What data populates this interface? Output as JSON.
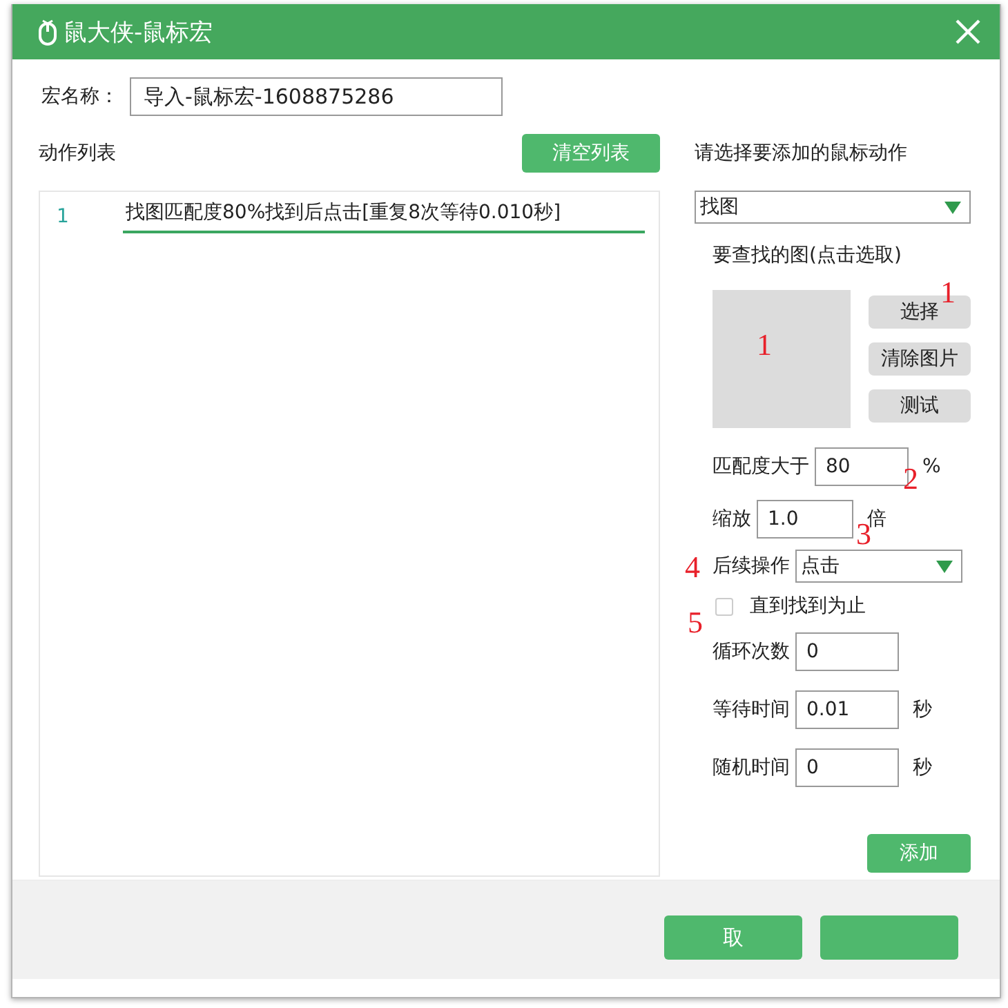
{
  "window": {
    "title": "鼠大侠-鼠标宏"
  },
  "macro_name": {
    "label": "宏名称：",
    "value": "导入-鼠标宏-1608875286"
  },
  "action_list": {
    "title": "动作列表",
    "clear_button": "清空列表",
    "rows": [
      {
        "index": "1",
        "text": "找图匹配度80%找到后点击[重复8次等待0.010秒]",
        "selected": true
      }
    ]
  },
  "action_panel": {
    "title": "请选择要添加的鼠标动作",
    "action_type": "找图",
    "image_section": {
      "label": "要查找的图(点击选取)",
      "preview_annotation": "1",
      "buttons": [
        {
          "label": "选择",
          "annotation": "1"
        },
        {
          "label": "清除图片"
        },
        {
          "label": "测试"
        }
      ]
    },
    "fields": [
      {
        "kind": "input",
        "label": "匹配度大于",
        "value": "80",
        "unit": "%",
        "annotation": "2"
      },
      {
        "kind": "input",
        "label": "缩放",
        "value": "1.0",
        "unit": "倍",
        "annotation": "3"
      },
      {
        "kind": "select",
        "label": "后续操作",
        "value": "点击",
        "annotation": "4"
      },
      {
        "kind": "checkbox",
        "label": "直到找到为止",
        "checked": false,
        "annotation": "5"
      },
      {
        "kind": "input",
        "label": "循环次数",
        "value": "0"
      },
      {
        "kind": "input",
        "label": "等待时间",
        "value": "0.01",
        "unit": "秒"
      },
      {
        "kind": "input",
        "label": "随机时间",
        "value": "0",
        "unit": "秒"
      }
    ],
    "add_button": "添加"
  },
  "footer": {
    "buttons": [
      {
        "kind": "text",
        "label": "取"
      },
      {
        "kind": "blank"
      }
    ]
  }
}
